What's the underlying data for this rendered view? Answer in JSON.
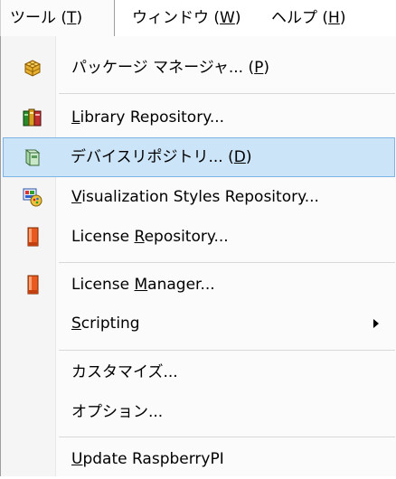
{
  "menubar": {
    "tools": {
      "pre": "ツール (",
      "mn": "T",
      "post": ")"
    },
    "window": {
      "pre": "ウィンドウ (",
      "mn": "W",
      "post": ")"
    },
    "help": {
      "pre": "ヘルプ (",
      "mn": "H",
      "post": ")"
    }
  },
  "menu": {
    "package_manager": {
      "pre": "パッケージ マネージャ... (",
      "mn": "P",
      "post": ")",
      "icon": "package-cube-icon"
    },
    "library_repository": {
      "pre": "",
      "mn": "L",
      "post": "ibrary Repository...",
      "icon": "books-icon"
    },
    "device_repository": {
      "pre": "デバイスリポジトリ... (",
      "mn": "D",
      "post": ")",
      "icon": "device-icon"
    },
    "visualization_styles_repository": {
      "pre": "",
      "mn": "V",
      "post": "isualization Styles Repository...",
      "icon": "palette-icon"
    },
    "license_repository": {
      "pre": "License ",
      "mn": "R",
      "post": "epository...",
      "icon": "license-icon"
    },
    "license_manager": {
      "pre": "License ",
      "mn": "M",
      "post": "anager...",
      "icon": "license-icon"
    },
    "scripting": {
      "pre": "",
      "mn": "S",
      "post": "cripting"
    },
    "customize": {
      "label": "カスタマイズ..."
    },
    "options": {
      "label": "オプション..."
    },
    "update_raspberrypi": {
      "pre": "",
      "mn": "U",
      "post": "pdate RaspberryPI"
    }
  },
  "colors": {
    "highlight_bg": "#cce4f8",
    "highlight_border": "#7db4e6"
  }
}
